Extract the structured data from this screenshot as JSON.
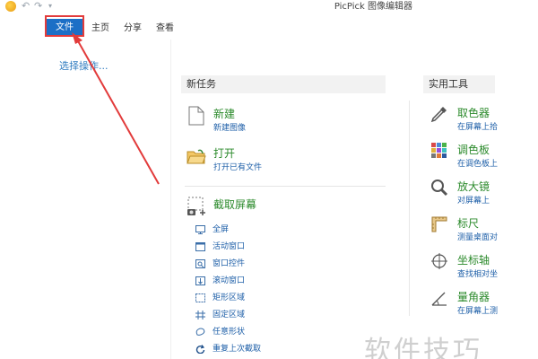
{
  "window": {
    "title": "PicPick 图像编辑器"
  },
  "quick_access": {
    "undo_icon": "undo-icon",
    "redo_icon": "redo-icon",
    "menu_icon": "dropdown-icon"
  },
  "tabs": [
    {
      "label": "文件"
    },
    {
      "label": "主页"
    },
    {
      "label": "分享"
    },
    {
      "label": "查看"
    }
  ],
  "left": {
    "choose_label": "选择操作..."
  },
  "new_task": {
    "header": "新任务",
    "new_item": {
      "title": "新建",
      "subtitle": "新建图像"
    },
    "open_item": {
      "title": "打开",
      "subtitle": "打开已有文件"
    },
    "capture": {
      "title": "截取屏幕",
      "items": [
        {
          "label": "全屏",
          "icon": "monitor-icon"
        },
        {
          "label": "活动窗口",
          "icon": "window-icon"
        },
        {
          "label": "窗口控件",
          "icon": "control-icon"
        },
        {
          "label": "滚动窗口",
          "icon": "scroll-window-icon"
        },
        {
          "label": "矩形区域",
          "icon": "rectangle-icon"
        },
        {
          "label": "固定区域",
          "icon": "fixed-region-icon"
        },
        {
          "label": "任意形状",
          "icon": "freehand-icon"
        },
        {
          "label": "重复上次截取",
          "icon": "repeat-icon"
        }
      ]
    }
  },
  "tools": {
    "header": "实用工具",
    "items": [
      {
        "title": "取色器",
        "subtitle": "在屏幕上拾",
        "icon": "eyedropper-icon"
      },
      {
        "title": "调色板",
        "subtitle": "在调色板上",
        "icon": "palette-icon"
      },
      {
        "title": "放大镜",
        "subtitle": "对屏幕上",
        "icon": "magnifier-icon"
      },
      {
        "title": "标尺",
        "subtitle": "测量桌面对",
        "icon": "ruler-icon"
      },
      {
        "title": "坐标轴",
        "subtitle": "查找相对坐",
        "icon": "crosshair-icon"
      },
      {
        "title": "量角器",
        "subtitle": "在屏幕上测",
        "icon": "protractor-icon"
      }
    ]
  },
  "watermark": {
    "text": "软件技巧"
  },
  "colors": {
    "accent": "#1c6fc6",
    "highlight": "#e23b3b",
    "title_green": "#2b8a2b",
    "link_blue": "#1e5fa8"
  }
}
